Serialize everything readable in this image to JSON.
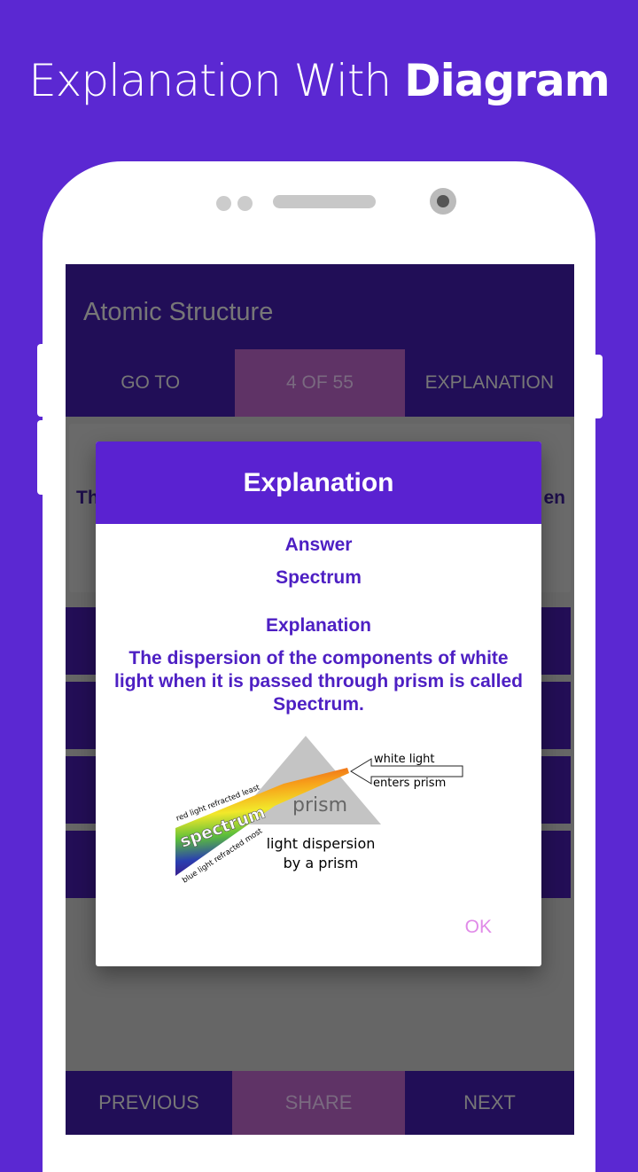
{
  "banner": {
    "prefix": "Explanation With",
    "bold": "Diagram"
  },
  "app": {
    "title": "Atomic Structure",
    "tabs": {
      "goto": "GO TO",
      "progress": "4 OF 55",
      "explanation": "EXPLANATION"
    },
    "question_fragment_left": "Th",
    "question_fragment_right": "en",
    "bottom": {
      "previous": "PREVIOUS",
      "share": "SHARE",
      "next": "NEXT"
    }
  },
  "dialog": {
    "title": "Explanation",
    "answer_label": "Answer",
    "answer": "Spectrum",
    "explanation_label": "Explanation",
    "explanation": "The dispersion of the components of white light when it is passed through prism is called Spectrum.",
    "ok": "OK",
    "diagram": {
      "white_light": "white light",
      "enters_prism": "enters prism",
      "prism": "prism",
      "spectrum": "spectrum",
      "red": "red light refracted least",
      "blue": "blue light refracted most",
      "caption1": "light dispersion",
      "caption2": "by a prism"
    }
  },
  "colors": {
    "background": "#5b28d2",
    "header": "#210e57",
    "accent": "#5a22d1",
    "ok": "#e08ae8"
  }
}
